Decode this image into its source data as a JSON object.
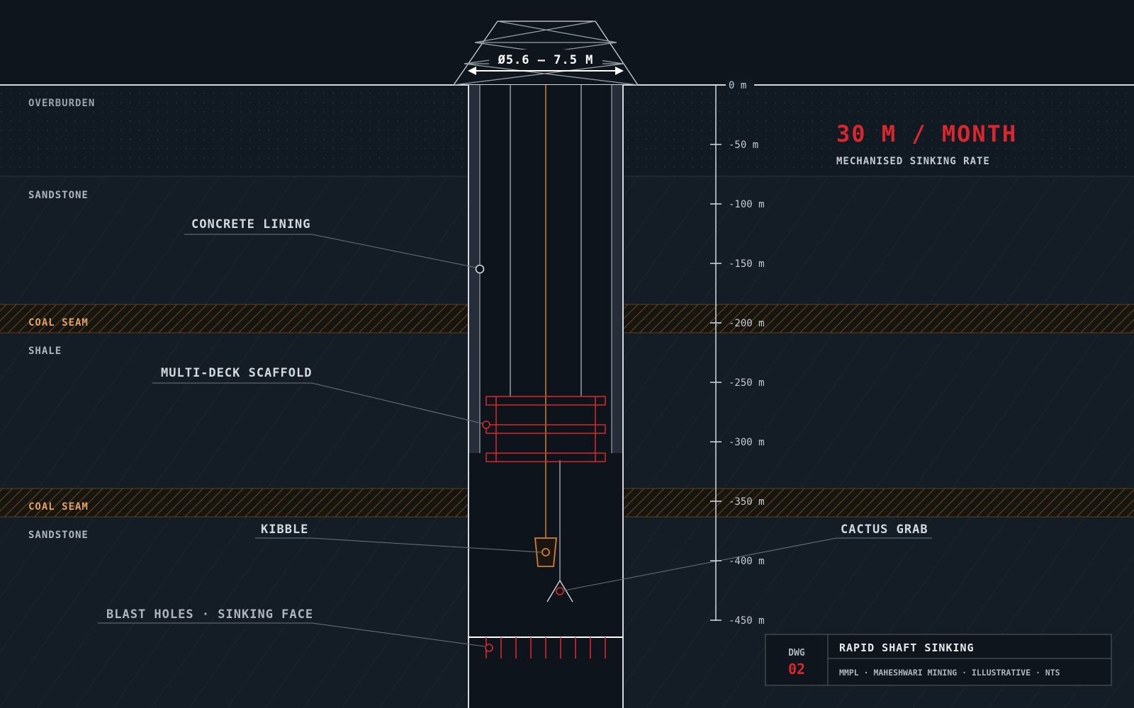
{
  "diameter_label": "Ø5.6 – 7.5 M",
  "strata": [
    {
      "name": "OVERBURDEN",
      "kind": "overburden"
    },
    {
      "name": "SANDSTONE",
      "kind": "rock"
    },
    {
      "name": "COAL SEAM",
      "kind": "coal"
    },
    {
      "name": "SHALE",
      "kind": "rock"
    },
    {
      "name": "COAL SEAM",
      "kind": "coal"
    },
    {
      "name": "SANDSTONE",
      "kind": "rock"
    }
  ],
  "depth_scale": [
    "0 m",
    "-50 m",
    "-100 m",
    "-150 m",
    "-200 m",
    "-250 m",
    "-300 m",
    "-350 m",
    "-400 m",
    "-450 m"
  ],
  "callouts": {
    "concrete_lining": "CONCRETE LINING",
    "scaffold": "MULTI-DECK SCAFFOLD",
    "kibble": "KIBBLE",
    "blast_holes": "BLAST HOLES · SINKING FACE",
    "cactus_grab": "CACTUS GRAB"
  },
  "headline": {
    "value": "30 M / MONTH",
    "caption": "MECHANISED SINKING RATE"
  },
  "title_block": {
    "dwg_label": "DWG",
    "dwg_number": "02",
    "title": "RAPID SHAFT SINKING",
    "subtitle": "MMPL · MAHESHWARI MINING · ILLUSTRATIVE · NTS"
  },
  "colors": {
    "background": "#0f151d",
    "line": "#d4d9e0",
    "accent_red": "#d9282d",
    "accent_orange": "#d0802e",
    "coal_label": "#e2a06a",
    "muted": "#8b939c"
  }
}
